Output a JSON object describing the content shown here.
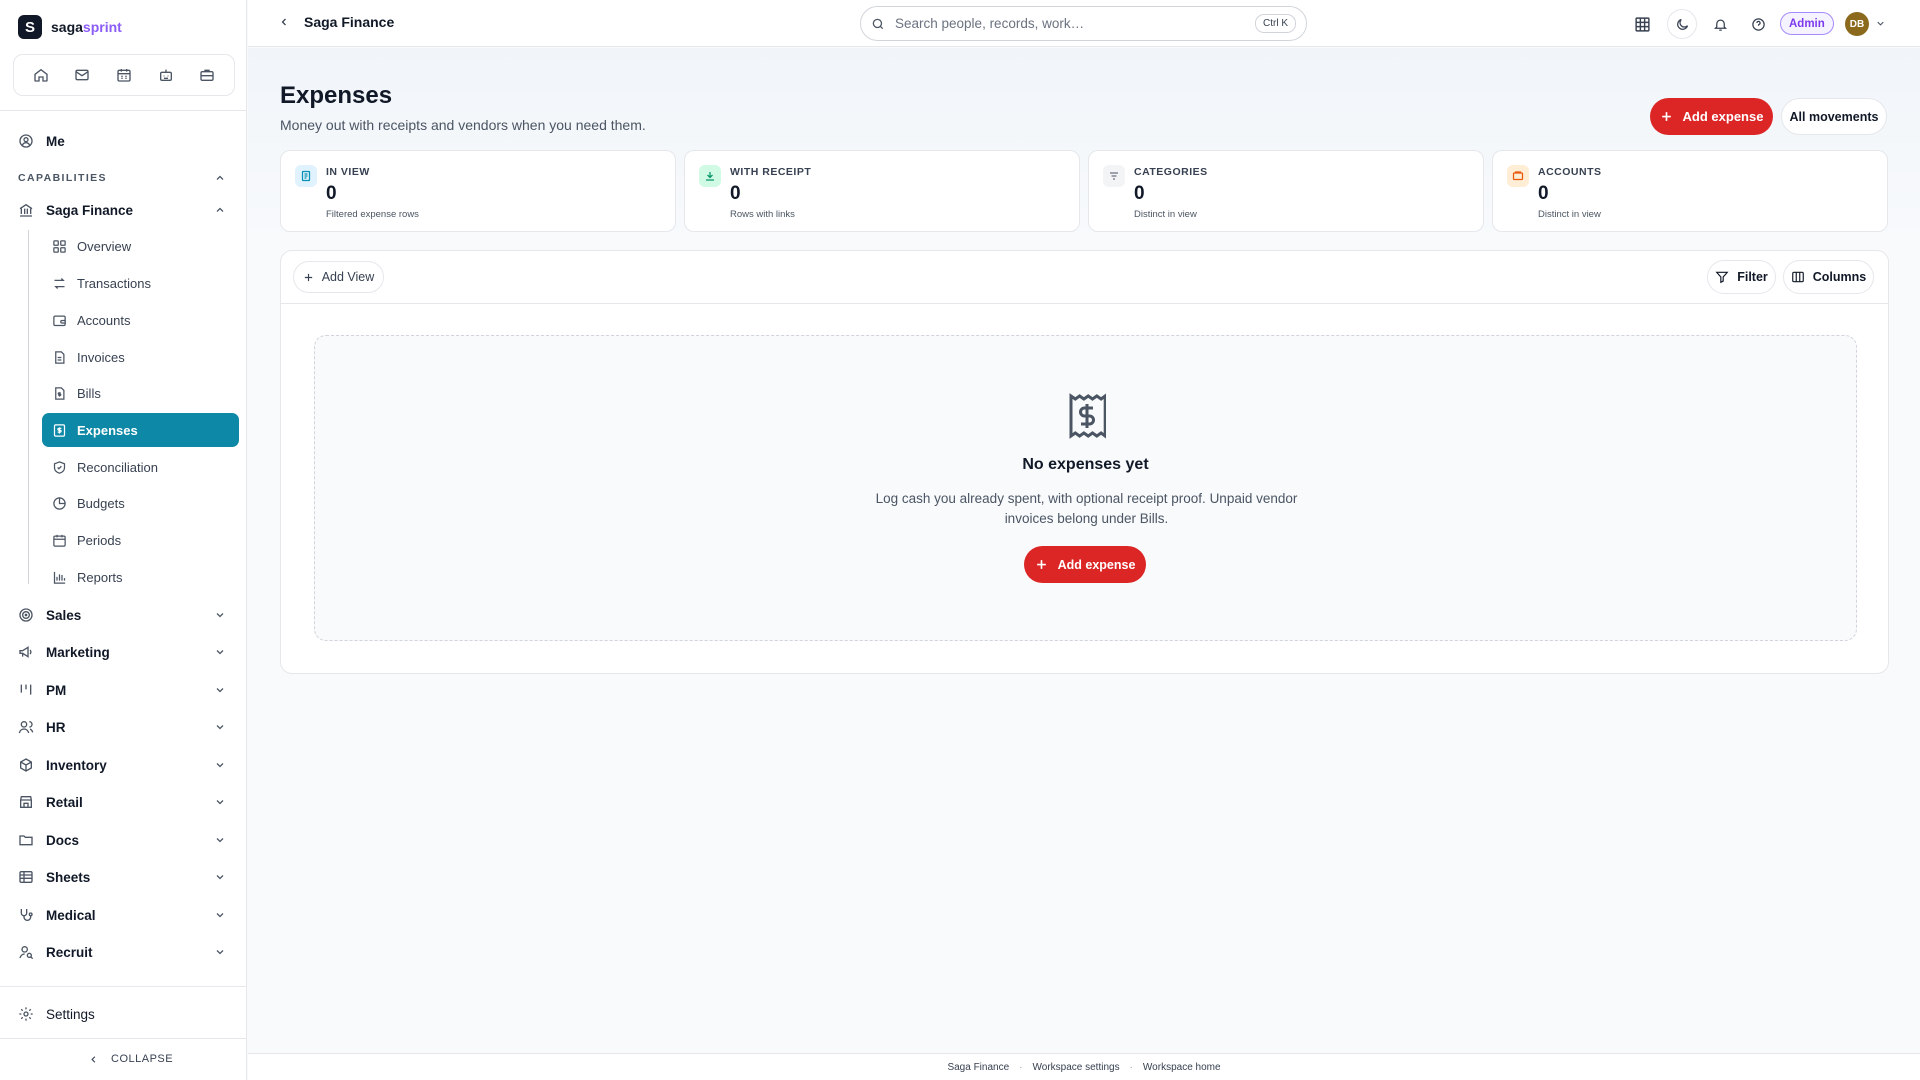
{
  "brand": {
    "logo_letter": "S",
    "name_part1": "saga",
    "name_part2": "sprint"
  },
  "quickbar": {
    "icons": [
      "home-icon",
      "mail-icon",
      "calendar-icon",
      "bot-icon",
      "briefcase-icon"
    ]
  },
  "sidebar": {
    "me_label": "Me",
    "section_label": "CAPABILITIES",
    "finance_label": "Saga Finance",
    "finance_items": [
      {
        "label": "Overview",
        "icon": "grid-icon"
      },
      {
        "label": "Transactions",
        "icon": "arrows-icon"
      },
      {
        "label": "Accounts",
        "icon": "wallet-icon"
      },
      {
        "label": "Invoices",
        "icon": "file-icon"
      },
      {
        "label": "Bills",
        "icon": "file-dollar-icon"
      },
      {
        "label": "Expenses",
        "icon": "receipt-icon",
        "active": true
      },
      {
        "label": "Reconciliation",
        "icon": "shield-check-icon"
      },
      {
        "label": "Budgets",
        "icon": "pie-icon"
      },
      {
        "label": "Periods",
        "icon": "calendar-icon"
      },
      {
        "label": "Reports",
        "icon": "bar-chart-icon"
      }
    ],
    "groups": [
      {
        "label": "Sales",
        "icon": "target-icon"
      },
      {
        "label": "Marketing",
        "icon": "megaphone-icon"
      },
      {
        "label": "PM",
        "icon": "kanban-icon"
      },
      {
        "label": "HR",
        "icon": "users-icon"
      },
      {
        "label": "Inventory",
        "icon": "box-icon"
      },
      {
        "label": "Retail",
        "icon": "store-icon"
      },
      {
        "label": "Docs",
        "icon": "folder-icon"
      },
      {
        "label": "Sheets",
        "icon": "table-icon"
      },
      {
        "label": "Medical",
        "icon": "stethoscope-icon"
      },
      {
        "label": "Recruit",
        "icon": "user-search-icon"
      }
    ],
    "settings_label": "Settings",
    "collapse_label": "COLLAPSE"
  },
  "topbar": {
    "breadcrumb": "Saga Finance",
    "search_placeholder": "Search people, records, work…",
    "search_shortcut": "Ctrl K",
    "admin_badge": "Admin",
    "avatar_initials": "DB"
  },
  "page": {
    "title": "Expenses",
    "subtitle": "Money out with receipts and vendors when you need them.",
    "add_expense_label": "Add expense",
    "all_movements_label": "All movements"
  },
  "stats": [
    {
      "label": "IN VIEW",
      "value": "0",
      "hint": "Filtered expense rows",
      "icon": "receipt-icon",
      "color": "#0891b2",
      "bg": "#e0f2fe"
    },
    {
      "label": "WITH RECEIPT",
      "value": "0",
      "hint": "Rows with links",
      "icon": "download-icon",
      "color": "#059669",
      "bg": "#d1fae5"
    },
    {
      "label": "CATEGORIES",
      "value": "0",
      "hint": "Distinct in view",
      "icon": "filter-lines-icon",
      "color": "#6b7280",
      "bg": "#f3f4f6"
    },
    {
      "label": "ACCOUNTS",
      "value": "0",
      "hint": "Distinct in view",
      "icon": "wallet-icon",
      "color": "#ea580c",
      "bg": "#ffedd5"
    }
  ],
  "toolbar": {
    "add_view_label": "Add View",
    "filter_label": "Filter",
    "columns_label": "Columns"
  },
  "empty_state": {
    "title": "No expenses yet",
    "description": "Log cash you already spent, with optional receipt proof. Unpaid vendor invoices belong under Bills.",
    "button_label": "Add expense"
  },
  "footer": {
    "links": [
      "Saga Finance",
      "Workspace settings",
      "Workspace home"
    ]
  }
}
